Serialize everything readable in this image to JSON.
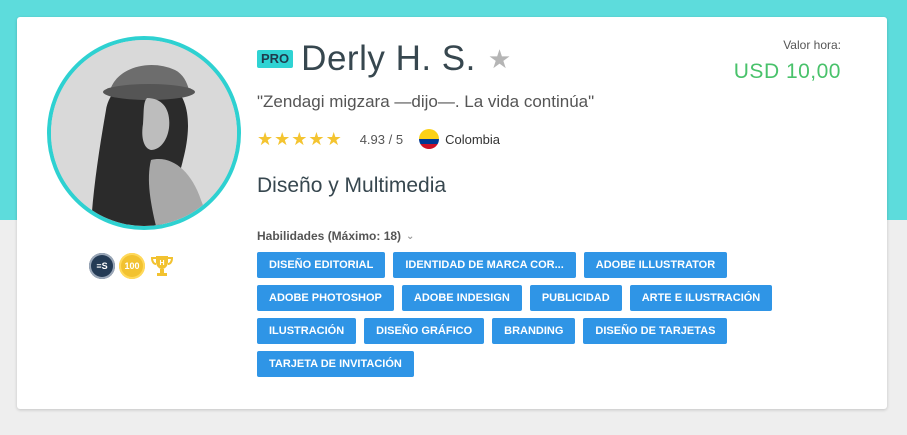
{
  "profile": {
    "pro_label": "PRO",
    "name": "Derly H. S.",
    "tagline": "\"Zendagi migzara —dijo—. La vida continúa\"",
    "rating": "4.93 / 5",
    "stars": 5,
    "country": "Colombia",
    "category": "Diseño y Multimedia"
  },
  "price": {
    "label": "Valor hora:",
    "value": "USD 10,00"
  },
  "badges": {
    "level": "≡S",
    "count": "100"
  },
  "skills": {
    "title": "Habilidades (Máximo: 18)",
    "items": [
      "DISEÑO EDITORIAL",
      "IDENTIDAD DE MARCA COR...",
      "ADOBE ILLUSTRATOR",
      "ADOBE PHOTOSHOP",
      "ADOBE INDESIGN",
      "PUBLICIDAD",
      "ARTE E ILUSTRACIÓN",
      "ILUSTRACIÓN",
      "DISEÑO GRÁFICO",
      "BRANDING",
      "DISEÑO DE TARJETAS",
      "TARJETA DE INVITACIÓN"
    ]
  },
  "colors": {
    "band": "#5ddcdc",
    "pro": "#2fd3d3",
    "chip": "#2f95e6",
    "price": "#49c26b",
    "star": "#f4c430"
  }
}
